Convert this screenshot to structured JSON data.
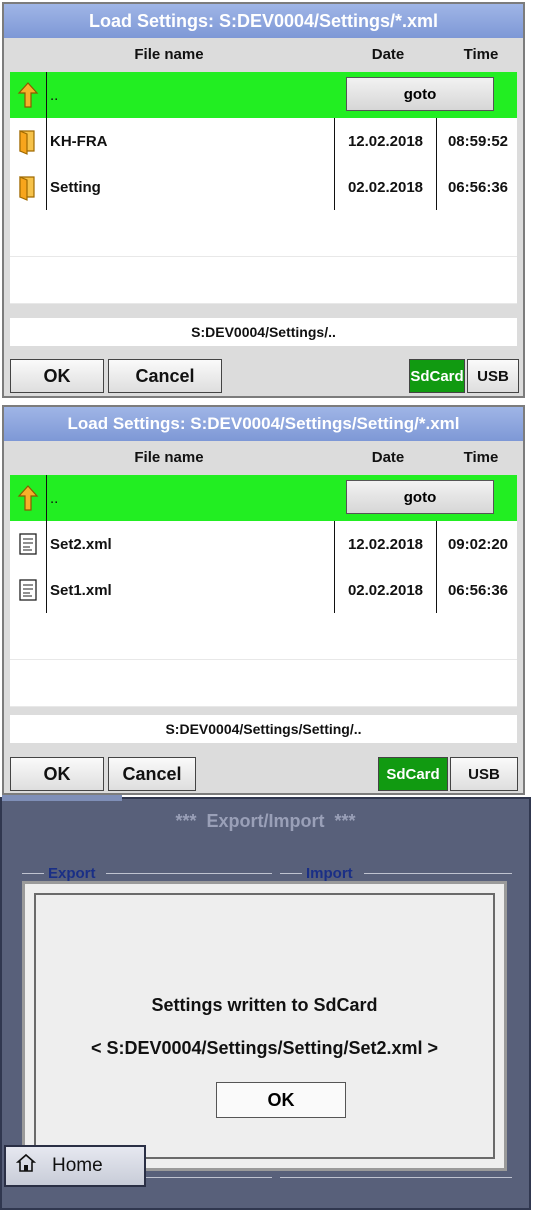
{
  "screen1": {
    "title": "Load Settings:  S:DEV0004/Settings/*.xml",
    "columns": {
      "name": "File name",
      "date": "Date",
      "time": "Time"
    },
    "up_row": {
      "name": "..",
      "goto_label": "goto"
    },
    "rows": [
      {
        "icon": "folder-icon",
        "name": "KH-FRA",
        "date": "12.02.2018",
        "time": "08:59:52"
      },
      {
        "icon": "folder-icon",
        "name": "Setting",
        "date": "02.02.2018",
        "time": "06:56:36"
      }
    ],
    "path": "S:DEV0004/Settings/..",
    "buttons": {
      "ok": "OK",
      "cancel": "Cancel",
      "sdcard": "SdCard",
      "usb": "USB"
    }
  },
  "screen2": {
    "title": "Load Settings:  S:DEV0004/Settings/Setting/*.xml",
    "columns": {
      "name": "File name",
      "date": "Date",
      "time": "Time"
    },
    "up_row": {
      "name": "..",
      "goto_label": "goto"
    },
    "rows": [
      {
        "icon": "xml-file-icon",
        "name": "Set2.xml",
        "date": "12.02.2018",
        "time": "09:02:20"
      },
      {
        "icon": "xml-file-icon",
        "name": "Set1.xml",
        "date": "02.02.2018",
        "time": "06:56:36"
      }
    ],
    "path": "S:DEV0004/Settings/Setting/..",
    "buttons": {
      "ok": "OK",
      "cancel": "Cancel",
      "sdcard": "SdCard",
      "usb": "USB"
    }
  },
  "screen3": {
    "title": "***  Export/Import  ***",
    "export_label": "Export",
    "import_label": "Import",
    "dialog": {
      "message": "Settings written to SdCard",
      "path": "< S:DEV0004/Settings/Setting/Set2.xml >",
      "ok": "OK"
    },
    "home_label": "Home"
  },
  "colors": {
    "title_blue": "#8aa3dd",
    "selected_green": "#22ee22",
    "active_button_green": "#119a11",
    "dialog_backdrop": "#58607a",
    "group_label_blue": "#1a2f86"
  }
}
